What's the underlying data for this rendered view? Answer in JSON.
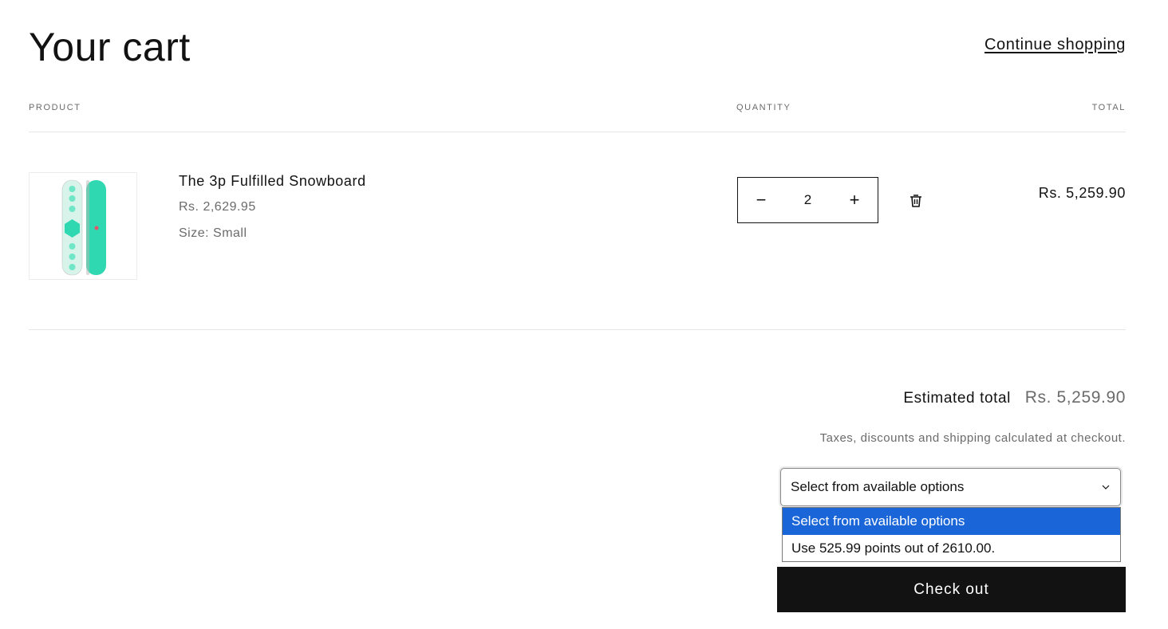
{
  "header": {
    "title": "Your cart",
    "continue_label": "Continue shopping"
  },
  "columns": {
    "product": "PRODUCT",
    "quantity": "QUANTITY",
    "total": "TOTAL"
  },
  "items": [
    {
      "name": "The 3p Fulfilled Snowboard",
      "price": "Rs. 2,629.95",
      "option": "Size: Small",
      "quantity": "2",
      "line_total": "Rs. 5,259.90",
      "image_icon": "snowboard-image"
    }
  ],
  "quantity_controls": {
    "minus_symbol": "−",
    "plus_symbol": "+"
  },
  "summary": {
    "estimated_label": "Estimated total",
    "estimated_value": "Rs. 5,259.90",
    "tax_note": "Taxes, discounts and shipping calculated at checkout."
  },
  "points_select": {
    "selected": "Select from available options",
    "options": [
      "Select from available options",
      "Use 525.99 points out of 2610.00."
    ]
  },
  "checkout": {
    "label": "Check out"
  },
  "colors": {
    "accent_selected": "#1a66d8",
    "button_bg": "#121212",
    "snowboard_teal": "#2fd8b0",
    "snowboard_pale": "#d7f3ea"
  }
}
